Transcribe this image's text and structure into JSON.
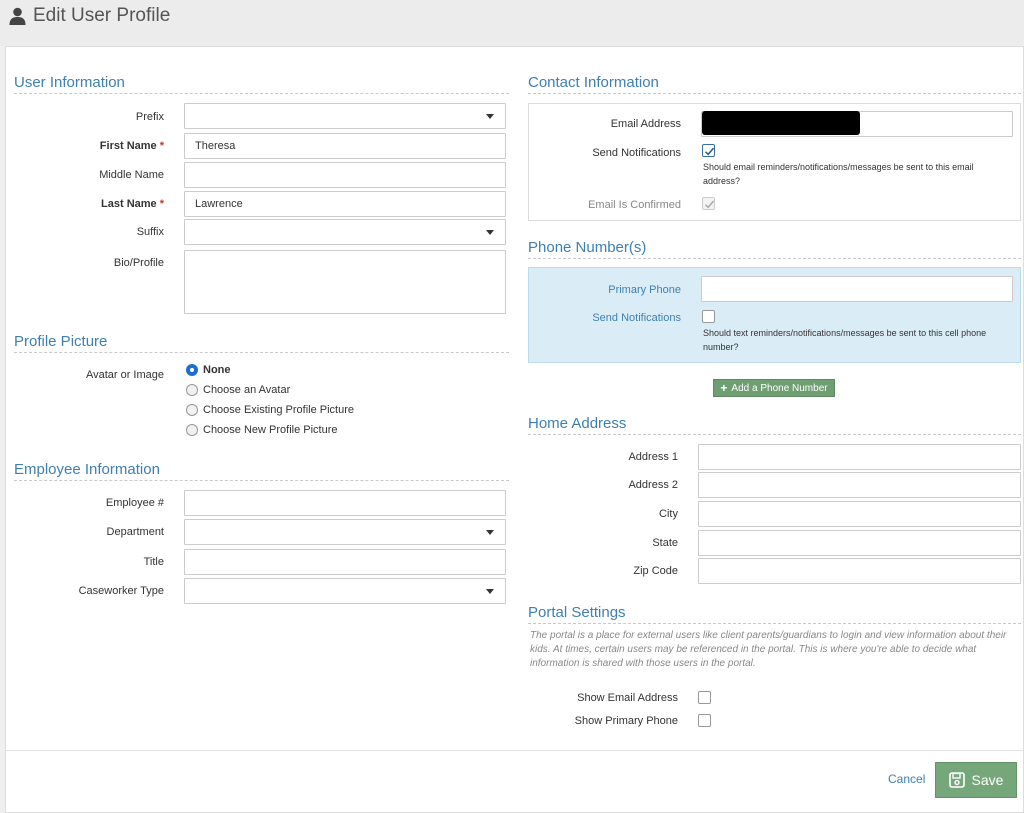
{
  "header": {
    "title": "Edit User Profile",
    "icon": "user-icon"
  },
  "user_info": {
    "title": "User Information",
    "prefix_label": "Prefix",
    "prefix_value": "",
    "first_name_label": "First Name",
    "first_name_value": "Theresa",
    "middle_name_label": "Middle Name",
    "middle_name_value": "",
    "last_name_label": "Last Name",
    "last_name_value": "Lawrence",
    "suffix_label": "Suffix",
    "suffix_value": "",
    "bio_label": "Bio/Profile",
    "bio_value": "",
    "required_mark": "*"
  },
  "profile_picture": {
    "title": "Profile Picture",
    "avatar_label": "Avatar or Image",
    "options": [
      "None",
      "Choose an Avatar",
      "Choose Existing Profile Picture",
      "Choose New Profile Picture"
    ],
    "selected": "None"
  },
  "employee_info": {
    "title": "Employee Information",
    "employee_num_label": "Employee #",
    "employee_num_value": "",
    "department_label": "Department",
    "department_value": "",
    "title_label": "Title",
    "title_value": "",
    "caseworker_label": "Caseworker Type",
    "caseworker_value": ""
  },
  "contact_info": {
    "title": "Contact Information",
    "email_label": "Email Address",
    "send_notifications_label": "Send Notifications",
    "send_notifications_checked": true,
    "email_help": "Should email reminders/notifications/messages be sent to this email address?",
    "email_confirmed_label": "Email Is Confirmed",
    "email_confirmed_checked": true
  },
  "phone_numbers": {
    "title": "Phone Number(s)",
    "primary_phone_label": "Primary Phone",
    "primary_phone_value": "",
    "send_notifications_label": "Send Notifications",
    "send_notifications_checked": false,
    "phone_help": "Should text reminders/notifications/messages be sent to this cell phone number?",
    "add_button_label": "Add a Phone Number"
  },
  "home_address": {
    "title": "Home Address",
    "address1_label": "Address 1",
    "address1_value": "",
    "address2_label": "Address 2",
    "address2_value": "",
    "city_label": "City",
    "city_value": "",
    "state_label": "State",
    "state_value": "",
    "zip_label": "Zip Code",
    "zip_value": ""
  },
  "portal_settings": {
    "title": "Portal Settings",
    "description": "The portal is a place for external users like client parents/guardians to login and view information about their kids. At times, certain users may be referenced in the portal. This is where you're able to decide what information is shared with those users in the portal.",
    "show_email_label": "Show Email Address",
    "show_email_checked": false,
    "show_phone_label": "Show Primary Phone",
    "show_phone_checked": false
  },
  "footer": {
    "cancel_label": "Cancel",
    "save_label": "Save"
  },
  "colors": {
    "accent": "#3f7fb1",
    "save_button": "#76a77a",
    "add_button": "#6e9e72",
    "phone_box": "#daedf7",
    "required": "#c0392b"
  }
}
